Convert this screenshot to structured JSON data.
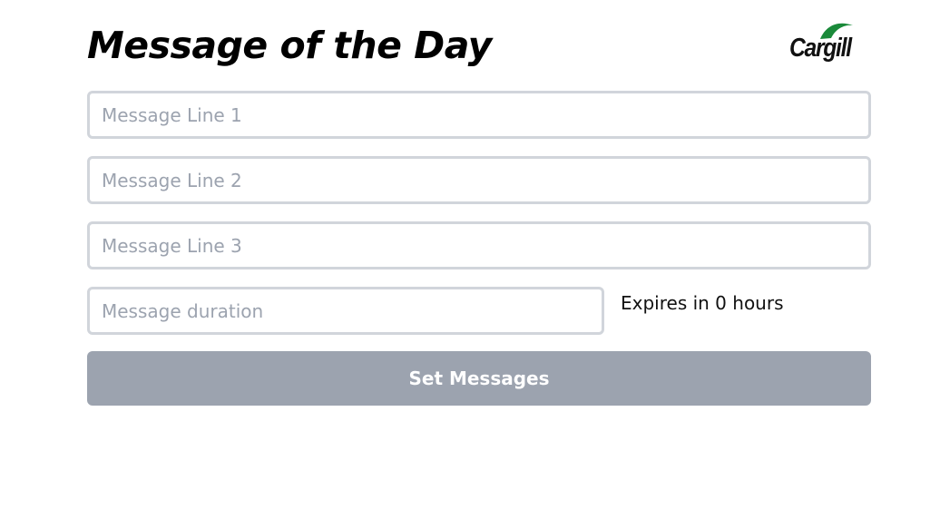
{
  "header": {
    "title": "Message of the Day",
    "logo_text": "Cargill",
    "logo_leaf_color": "#1a8a3a"
  },
  "form": {
    "line1": {
      "value": "",
      "placeholder": "Message Line 1"
    },
    "line2": {
      "value": "",
      "placeholder": "Message Line 2"
    },
    "line3": {
      "value": "",
      "placeholder": "Message Line 3"
    },
    "duration": {
      "value": "",
      "placeholder": "Message duration"
    },
    "expires_text": "Expires in 0 hours",
    "submit_label": "Set Messages",
    "submit_disabled": true
  },
  "colors": {
    "input_border": "#d1d5db",
    "placeholder": "#9ca3af",
    "button_disabled_bg": "#9ca3af"
  }
}
